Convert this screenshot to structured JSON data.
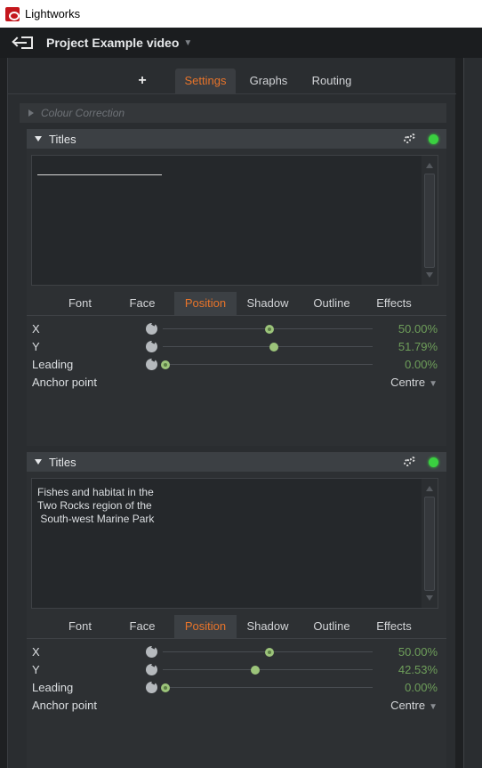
{
  "app": {
    "title": "Lightworks"
  },
  "project": {
    "name": "Project Example video"
  },
  "tabs": [
    {
      "label": "+"
    },
    {
      "label": "Settings",
      "active": true
    },
    {
      "label": "Graphs"
    },
    {
      "label": "Routing"
    }
  ],
  "colour_correction": {
    "label": "Colour Correction"
  },
  "subtab_labels": [
    "Font",
    "Face",
    "Position",
    "Shadow",
    "Outline",
    "Effects"
  ],
  "sections": [
    {
      "title": "Titles",
      "text": "",
      "x_label": "X",
      "x_value": "50.00%",
      "y_label": "Y",
      "y_value": "51.79%",
      "leading_label": "Leading",
      "leading_value": "0.00%",
      "anchor_label": "Anchor point",
      "anchor_value": "Centre"
    },
    {
      "title": "Titles",
      "text": "Fishes and habitat in the\nTwo Rocks region of the\n South-west Marine Park",
      "x_label": "X",
      "x_value": "50.00%",
      "y_label": "Y",
      "y_value": "42.53%",
      "leading_label": "Leading",
      "leading_value": "0.00%",
      "anchor_label": "Anchor point",
      "anchor_value": "Centre"
    }
  ],
  "colors": {
    "accent": "#e8742a",
    "value_green": "#6e9e5a",
    "led_green": "#3ad040"
  }
}
